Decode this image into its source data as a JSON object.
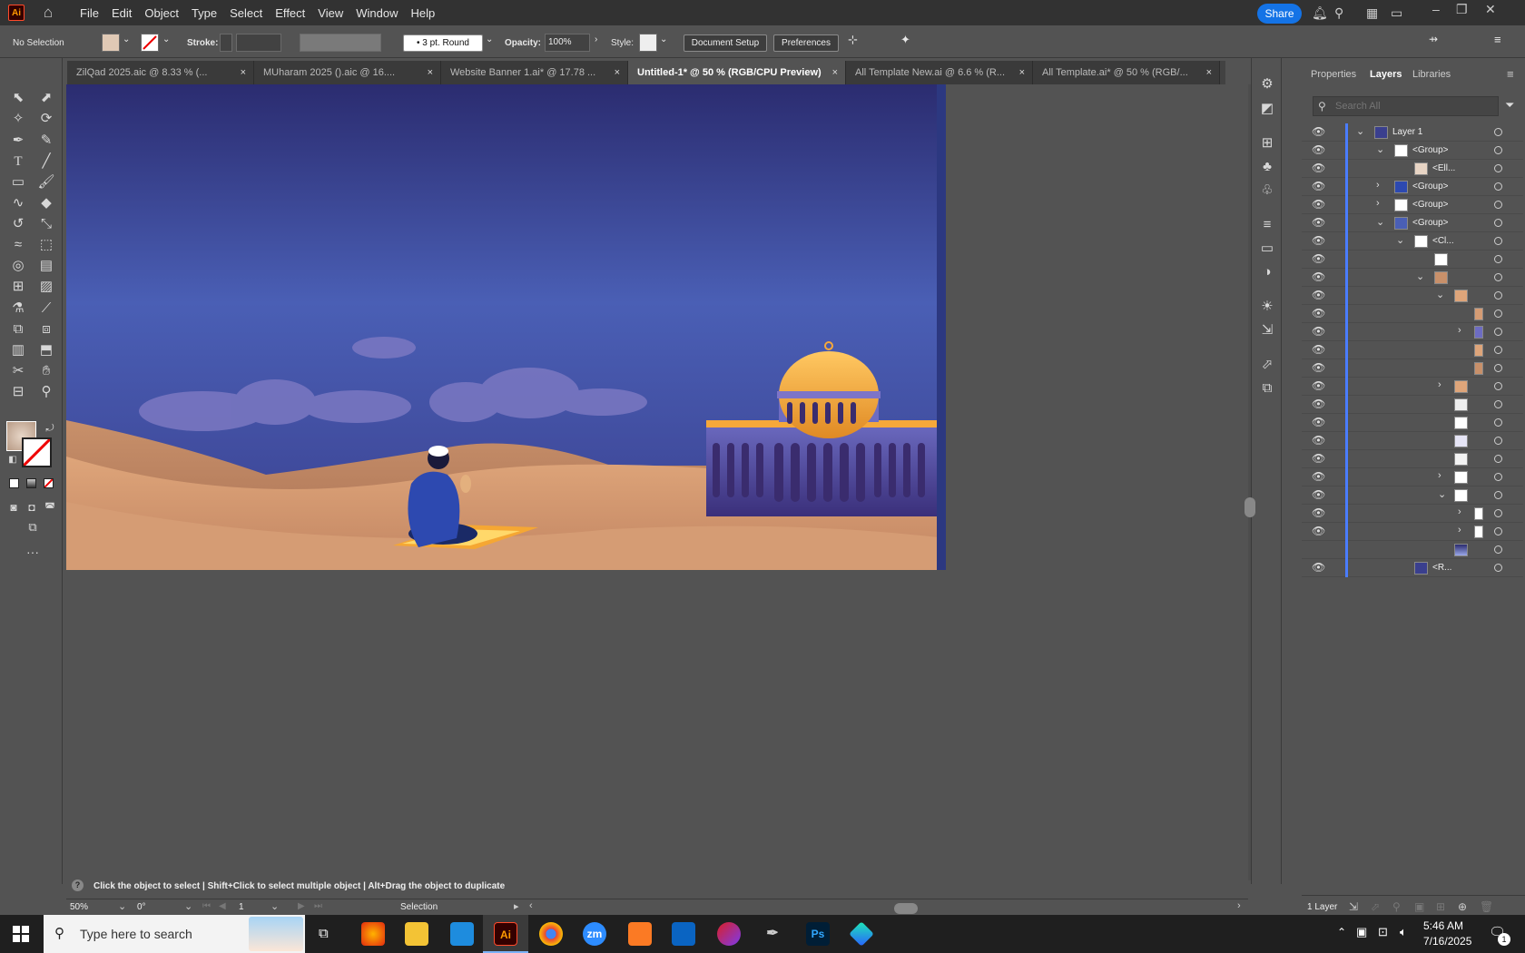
{
  "app": {
    "logo": "Ai"
  },
  "menu": [
    "File",
    "Edit",
    "Object",
    "Type",
    "Select",
    "Effect",
    "View",
    "Window",
    "Help"
  ],
  "share_label": "Share",
  "control": {
    "selection": "No Selection",
    "stroke_label": "Stroke:",
    "brush": "3 pt. Round",
    "opacity_label": "Opacity:",
    "opacity_value": "100%",
    "style_label": "Style:",
    "doc_setup": "Document Setup",
    "preferences": "Preferences"
  },
  "tabs": [
    {
      "label": "ZilQad 2025.aic @ 8.33 % (..."
    },
    {
      "label": "MUharam 2025 ().aic @ 16...."
    },
    {
      "label": "Website Banner 1.ai* @ 17.78 ..."
    },
    {
      "label": "Untitled-1* @ 50 % (RGB/CPU Preview)"
    },
    {
      "label": "All Template New.ai @ 6.6 % (R..."
    },
    {
      "label": "All Template.ai* @ 50 % (RGB/..."
    }
  ],
  "tab_close": "×",
  "panel": {
    "tabs": [
      "Properties",
      "Layers",
      "Libraries"
    ],
    "search_placeholder": "Search All",
    "layers": [
      {
        "name": "Layer 1"
      },
      {
        "name": "<Group>"
      },
      {
        "name": "<Ell..."
      },
      {
        "name": "<Group>"
      },
      {
        "name": "<Group>"
      },
      {
        "name": "<Group>"
      },
      {
        "name": "<Cl..."
      },
      {
        "name": "<R..."
      }
    ],
    "footer": "1 Layer"
  },
  "status": {
    "hint_parts": [
      "Click the object to select",
      "Shift+Click to select multiple object",
      "Alt+Drag the object to duplicate"
    ],
    "separator": "|",
    "zoom": "50%",
    "rotation": "0°",
    "artboard": "1",
    "tool": "Selection"
  },
  "taskbar": {
    "search_placeholder": "Type here to search",
    "time": "5:46 AM",
    "date": "7/16/2025",
    "notification_count": "1",
    "apps": [
      "firefox",
      "file-explorer",
      "vscode",
      "illustrator",
      "chrome",
      "zoom",
      "xampp",
      "outlook",
      "creative-cloud",
      "pen-tool",
      "photoshop",
      "app"
    ],
    "app_labels": {
      "illustrator": "Ai",
      "zoom": "zm",
      "photoshop": "Ps"
    }
  },
  "colors": {
    "accent": "#1473e6",
    "sky_top": "#2b2c70",
    "sky_mid": "#4a5fb5",
    "sand": "#d8a070",
    "dome": "#f2a93b",
    "layer_bar": "#4a7dff"
  }
}
